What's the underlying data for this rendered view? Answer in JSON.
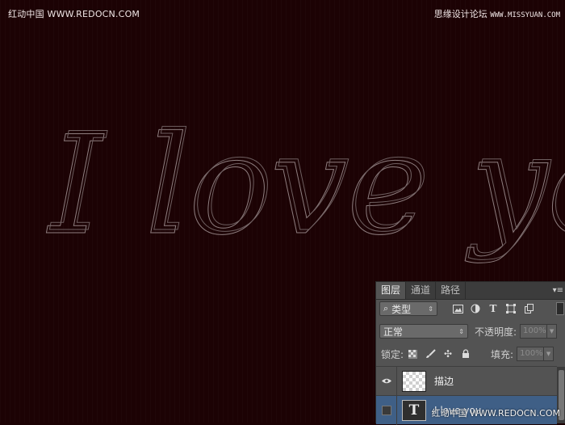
{
  "watermarks": {
    "top_left": "红动中国 WWW.REDOCN.COM",
    "top_right_cn": "思缘设计论坛",
    "top_right_url": "WWW.MISSYUAN.COM",
    "bottom_right": "红动中国 WWW.REDOCN.COM"
  },
  "canvas": {
    "script_text": "I love you",
    "background_color": "#1c0204",
    "stroke_color": "#9a8a8a"
  },
  "layers_panel": {
    "tabs": [
      "图层",
      "通道",
      "路径"
    ],
    "active_tab": "图层",
    "filter": {
      "label": "类型"
    },
    "blend_mode": "正常",
    "opacity": {
      "label": "不透明度:",
      "value": "100%"
    },
    "lock_label": "锁定:",
    "fill": {
      "label": "填充:",
      "value": "100%"
    },
    "layers": [
      {
        "name": "描边",
        "type": "pixel",
        "visible": true,
        "selected": false
      },
      {
        "name": "I love you",
        "type": "text",
        "visible": false,
        "selected": true
      }
    ]
  }
}
